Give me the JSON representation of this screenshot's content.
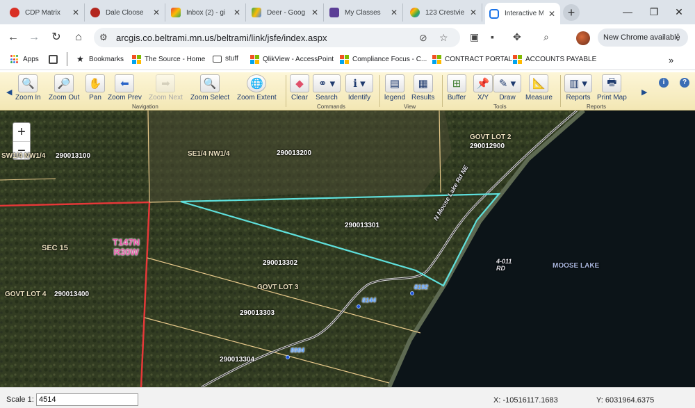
{
  "browser": {
    "tabs": [
      {
        "title": "CDP Matrix",
        "favicon_color": "#d93025",
        "active": false
      },
      {
        "title": "Dale Cloose",
        "favicon_color": "#b3261e",
        "active": false
      },
      {
        "title": "Inbox (2) - gi",
        "favicon_color": "#ea4335",
        "active": false
      },
      {
        "title": "Deer - Goog",
        "favicon_color": "#34a853",
        "active": false
      },
      {
        "title": "My Classes",
        "favicon_color": "#5b3e96",
        "active": false
      },
      {
        "title": "123 Crestvie",
        "favicon_color": "#fbbc04",
        "active": false
      },
      {
        "title": "Interactive M",
        "favicon_color": "#1a73e8",
        "active": true
      }
    ],
    "url": "arcgis.co.beltrami.mn.us/beltrami/link/jsfe/index.aspx",
    "update_button": "New Chrome available",
    "bookmarks": [
      {
        "label": "Apps",
        "icon": "apps-grid-icon"
      },
      {
        "label": "",
        "icon": "tab-groups-icon"
      },
      {
        "label": "Bookmarks",
        "icon": "star-icon"
      },
      {
        "label": "The Source - Home",
        "icon": "microsoft-icon"
      },
      {
        "label": "stuff",
        "icon": "folder-icon"
      },
      {
        "label": "QlikView - AccessPoint",
        "icon": "microsoft-icon"
      },
      {
        "label": "Compliance Focus - C...",
        "icon": "microsoft-icon"
      },
      {
        "label": "CONTRACT PORTAL",
        "icon": "microsoft-icon"
      },
      {
        "label": "ACCOUNTS PAYABLE",
        "icon": "microsoft-icon"
      }
    ]
  },
  "toolbar": {
    "tools": [
      {
        "label": "Zoom In",
        "icon": "zoom-in-icon",
        "enabled": true
      },
      {
        "label": "Zoom Out",
        "icon": "zoom-out-icon",
        "enabled": true
      },
      {
        "label": "Pan",
        "icon": "hand-icon",
        "enabled": true
      },
      {
        "label": "Zoom Prev",
        "icon": "arrow-left-icon",
        "enabled": true
      },
      {
        "label": "Zoom Next",
        "icon": "arrow-right-icon",
        "enabled": false
      },
      {
        "label": "Zoom Select",
        "icon": "magnifier-icon",
        "enabled": true
      },
      {
        "label": "Zoom Extent",
        "icon": "globe-icon",
        "enabled": true
      },
      {
        "label": "Clear",
        "icon": "eraser-icon",
        "enabled": true
      },
      {
        "label": "Search",
        "icon": "binoculars-icon",
        "enabled": true
      },
      {
        "label": "Identify",
        "icon": "identify-icon",
        "enabled": true
      },
      {
        "label": "legend",
        "icon": "layers-icon",
        "enabled": true
      },
      {
        "label": "Results",
        "icon": "table-icon",
        "enabled": true
      },
      {
        "label": "Buffer",
        "icon": "buffer-icon",
        "enabled": true
      },
      {
        "label": "X/Y",
        "icon": "pin-icon",
        "enabled": true
      },
      {
        "label": "Draw",
        "icon": "pencil-icon",
        "enabled": true
      },
      {
        "label": "Measure",
        "icon": "ruler-icon",
        "enabled": true
      },
      {
        "label": "Reports",
        "icon": "reports-icon",
        "enabled": true
      },
      {
        "label": "Print Map",
        "icon": "printer-icon",
        "enabled": true
      }
    ],
    "groups": [
      "Navigation",
      "Commands",
      "View",
      "Tools",
      "Reports"
    ]
  },
  "map": {
    "labels": {
      "parcels": [
        "290013100",
        "290013200",
        "290012900",
        "290013301",
        "290013302",
        "290013400",
        "290013303",
        "290013304"
      ],
      "sections": [
        "SW1/4 NW1/4",
        "SE1/4 NW1/4",
        "SEC 15",
        "GOVT LOT 2",
        "GOVT LOT 3",
        "GOVT LOT 4"
      ],
      "township": "T147N",
      "range": "R30W",
      "road": "N Moose Lake Rd NE",
      "road_short": "4-011 RD",
      "lake": "MOOSE LAKE",
      "addresses": [
        "8192",
        "8144",
        "8084"
      ]
    },
    "colors": {
      "selection": "#5fe0dc",
      "section_line": "#e63838",
      "parcel_line": "#e8c98b",
      "water": "#0c1418"
    }
  },
  "status": {
    "scale_label": "Scale 1:",
    "scale_value": "4514",
    "x": "X:  -10516117.1683",
    "y": "Y:  6031964.6375"
  }
}
